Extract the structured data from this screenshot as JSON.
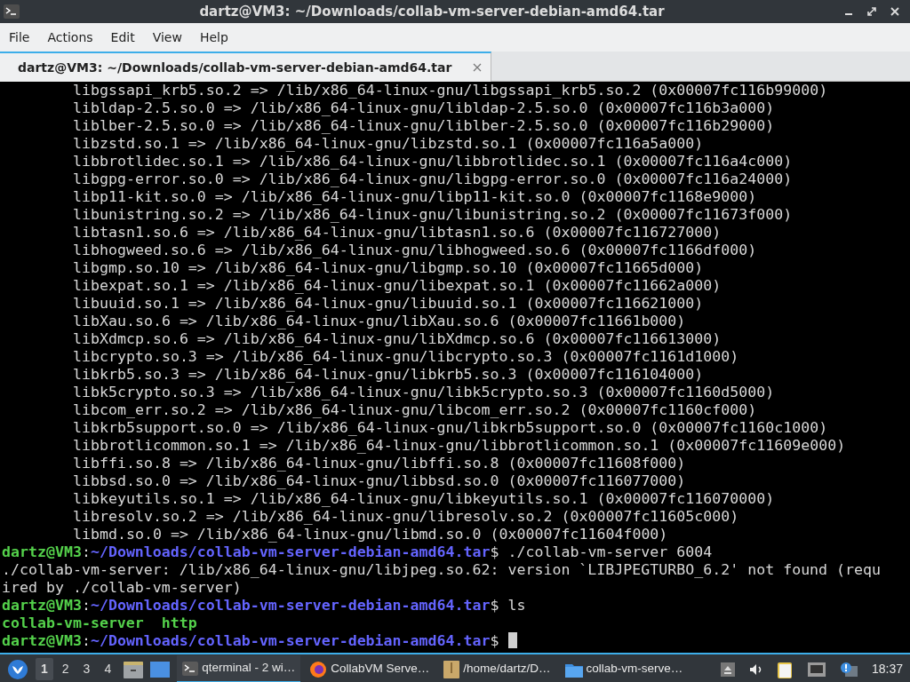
{
  "window": {
    "title": "dartz@VM3: ~/Downloads/collab-vm-server-debian-amd64.tar"
  },
  "menu": [
    "File",
    "Actions",
    "Edit",
    "View",
    "Help"
  ],
  "tabs": [
    {
      "label": "dartz@VM3: ~/Downloads/collab-vm-server-debian-amd64.tar",
      "selected": true
    }
  ],
  "terminal": {
    "lines": [
      {
        "kind": "lib",
        "text": "libgssapi_krb5.so.2 => /lib/x86_64-linux-gnu/libgssapi_krb5.so.2 (0x00007fc116b99000)"
      },
      {
        "kind": "lib",
        "text": "libldap-2.5.so.0 => /lib/x86_64-linux-gnu/libldap-2.5.so.0 (0x00007fc116b3a000)"
      },
      {
        "kind": "lib",
        "text": "liblber-2.5.so.0 => /lib/x86_64-linux-gnu/liblber-2.5.so.0 (0x00007fc116b29000)"
      },
      {
        "kind": "lib",
        "text": "libzstd.so.1 => /lib/x86_64-linux-gnu/libzstd.so.1 (0x00007fc116a5a000)"
      },
      {
        "kind": "lib",
        "text": "libbrotlidec.so.1 => /lib/x86_64-linux-gnu/libbrotlidec.so.1 (0x00007fc116a4c000)"
      },
      {
        "kind": "lib",
        "text": "libgpg-error.so.0 => /lib/x86_64-linux-gnu/libgpg-error.so.0 (0x00007fc116a24000)"
      },
      {
        "kind": "lib",
        "text": "libp11-kit.so.0 => /lib/x86_64-linux-gnu/libp11-kit.so.0 (0x00007fc1168e9000)"
      },
      {
        "kind": "lib",
        "text": "libunistring.so.2 => /lib/x86_64-linux-gnu/libunistring.so.2 (0x00007fc11673f000)"
      },
      {
        "kind": "lib",
        "text": "libtasn1.so.6 => /lib/x86_64-linux-gnu/libtasn1.so.6 (0x00007fc116727000)"
      },
      {
        "kind": "lib",
        "text": "libhogweed.so.6 => /lib/x86_64-linux-gnu/libhogweed.so.6 (0x00007fc1166df000)"
      },
      {
        "kind": "lib",
        "text": "libgmp.so.10 => /lib/x86_64-linux-gnu/libgmp.so.10 (0x00007fc11665d000)"
      },
      {
        "kind": "lib",
        "text": "libexpat.so.1 => /lib/x86_64-linux-gnu/libexpat.so.1 (0x00007fc11662a000)"
      },
      {
        "kind": "lib",
        "text": "libuuid.so.1 => /lib/x86_64-linux-gnu/libuuid.so.1 (0x00007fc116621000)"
      },
      {
        "kind": "lib",
        "text": "libXau.so.6 => /lib/x86_64-linux-gnu/libXau.so.6 (0x00007fc11661b000)"
      },
      {
        "kind": "lib",
        "text": "libXdmcp.so.6 => /lib/x86_64-linux-gnu/libXdmcp.so.6 (0x00007fc116613000)"
      },
      {
        "kind": "lib",
        "text": "libcrypto.so.3 => /lib/x86_64-linux-gnu/libcrypto.so.3 (0x00007fc1161d1000)"
      },
      {
        "kind": "lib",
        "text": "libkrb5.so.3 => /lib/x86_64-linux-gnu/libkrb5.so.3 (0x00007fc116104000)"
      },
      {
        "kind": "lib",
        "text": "libk5crypto.so.3 => /lib/x86_64-linux-gnu/libk5crypto.so.3 (0x00007fc1160d5000)"
      },
      {
        "kind": "lib",
        "text": "libcom_err.so.2 => /lib/x86_64-linux-gnu/libcom_err.so.2 (0x00007fc1160cf000)"
      },
      {
        "kind": "lib",
        "text": "libkrb5support.so.0 => /lib/x86_64-linux-gnu/libkrb5support.so.0 (0x00007fc1160c1000)"
      },
      {
        "kind": "lib",
        "text": "libbrotlicommon.so.1 => /lib/x86_64-linux-gnu/libbrotlicommon.so.1 (0x00007fc11609e000)"
      },
      {
        "kind": "lib",
        "text": "libffi.so.8 => /lib/x86_64-linux-gnu/libffi.so.8 (0x00007fc11608f000)"
      },
      {
        "kind": "lib",
        "text": "libbsd.so.0 => /lib/x86_64-linux-gnu/libbsd.so.0 (0x00007fc116077000)"
      },
      {
        "kind": "lib",
        "text": "libkeyutils.so.1 => /lib/x86_64-linux-gnu/libkeyutils.so.1 (0x00007fc116070000)"
      },
      {
        "kind": "lib",
        "text": "libresolv.so.2 => /lib/x86_64-linux-gnu/libresolv.so.2 (0x00007fc11605c000)"
      },
      {
        "kind": "lib",
        "text": "libmd.so.0 => /lib/x86_64-linux-gnu/libmd.so.0 (0x00007fc11604f000)"
      },
      {
        "kind": "prompt",
        "user": "dartz@VM3",
        "separator": ":",
        "path": "~/Downloads/collab-vm-server-debian-amd64.tar",
        "command": "$ ./collab-vm-server 6004"
      },
      {
        "kind": "plain",
        "text": "./collab-vm-server: /lib/x86_64-linux-gnu/libjpeg.so.62: version `LIBJPEGTURBO_6.2' not found (requ"
      },
      {
        "kind": "plain",
        "text": "ired by ./collab-vm-server)"
      },
      {
        "kind": "prompt",
        "user": "dartz@VM3",
        "separator": ":",
        "path": "~/Downloads/collab-vm-server-debian-amd64.tar",
        "command": "$ ls"
      },
      {
        "kind": "listing",
        "items": [
          "collab-vm-server",
          "http"
        ]
      },
      {
        "kind": "prompt",
        "user": "dartz@VM3",
        "separator": ":",
        "path": "~/Downloads/collab-vm-server-debian-amd64.tar",
        "command": "$",
        "cursor": true
      }
    ]
  },
  "taskbar": {
    "workspaces": [
      {
        "label": "1",
        "selected": true
      },
      {
        "label": "2",
        "selected": false
      },
      {
        "label": "3",
        "selected": false
      },
      {
        "label": "4",
        "selected": false
      }
    ],
    "tasks": [
      {
        "kind": "terminal",
        "label": "qterminal - 2 wi…",
        "selected": true
      },
      {
        "kind": "browser",
        "label": "CollabVM Serve…",
        "selected": false
      },
      {
        "kind": "archive",
        "label": "/home/dartz/D…",
        "selected": false
      },
      {
        "kind": "folder",
        "label": "collab-vm-serve…",
        "selected": false
      }
    ],
    "clock": "18:37"
  }
}
